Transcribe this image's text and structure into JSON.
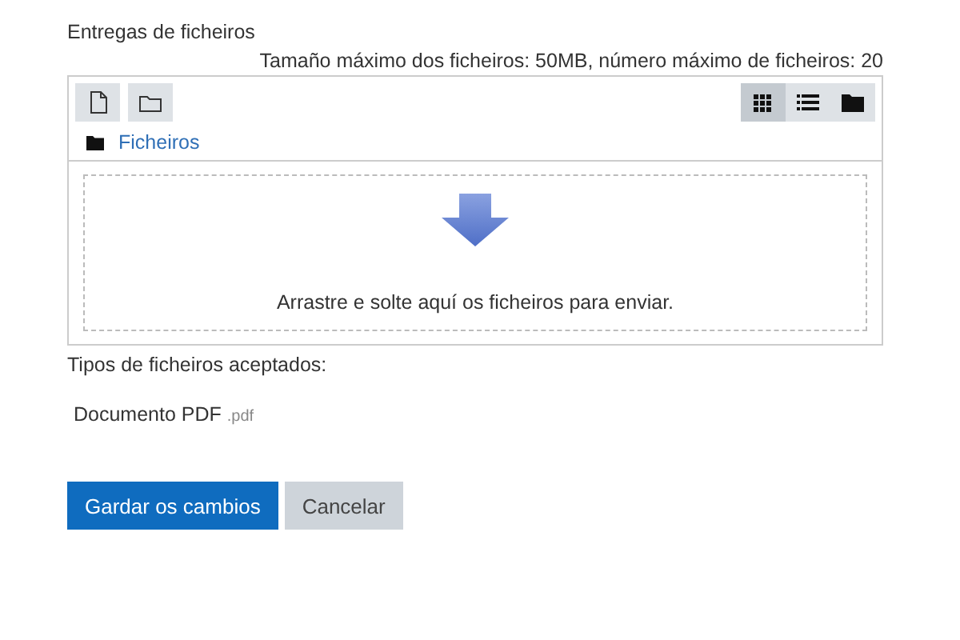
{
  "field_label": "Entregas de ficheiros",
  "limits": "Tamaño máximo dos ficheiros: 50MB, número máximo de ficheiros: 20",
  "toolbar": {
    "actions": [
      {
        "kind": "file"
      },
      {
        "kind": "folder"
      }
    ],
    "view_modes": [
      {
        "kind": "grid",
        "selected": true
      },
      {
        "kind": "list",
        "selected": false
      },
      {
        "kind": "tree",
        "selected": false
      }
    ]
  },
  "path": "Ficheiros",
  "drop_hint": "Arrastre e solte aquí os ficheiros para enviar.",
  "accepted_label": "Tipos de ficheiros aceptados:",
  "accepted_types": [
    {
      "name": "Documento PDF",
      "ext": ".pdf"
    }
  ],
  "buttons": [
    {
      "label": "Gardar os cambios",
      "kind": "primary"
    },
    {
      "label": "Cancelar",
      "kind": "secondary"
    }
  ]
}
